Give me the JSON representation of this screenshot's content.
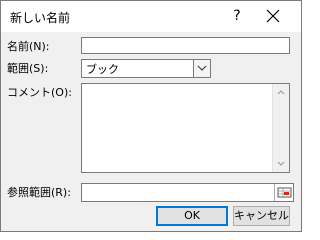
{
  "window": {
    "title": "新しい名前",
    "help_glyph": "?",
    "close_icon": "close-icon"
  },
  "form": {
    "name_label": "名前(N):",
    "name_value": "",
    "scope_label": "範囲(S):",
    "scope_value": "ブック",
    "comment_label": "コメント(O):",
    "comment_value": "",
    "refers_to_label": "参照範囲(R):",
    "refers_to_value": ""
  },
  "buttons": {
    "ok": "OK",
    "cancel": "キャンセル"
  },
  "colors": {
    "accent": "#0078d7",
    "collapse_icon_red": "#d42a1c"
  }
}
